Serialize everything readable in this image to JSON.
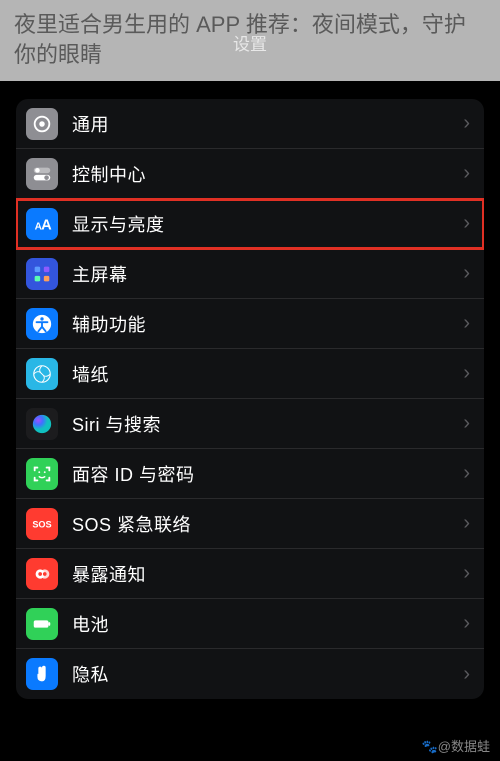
{
  "article_title": "夜里适合男生用的 APP 推荐：夜间模式，守护你的眼睛",
  "header": {
    "title": "设置"
  },
  "list": [
    {
      "label": "通用",
      "icon": "gear-icon",
      "bg": "bg-gray",
      "hl": false
    },
    {
      "label": "控制中心",
      "icon": "toggles-icon",
      "bg": "bg-gray2",
      "hl": false
    },
    {
      "label": "显示与亮度",
      "icon": "text-size-icon",
      "bg": "bg-blue",
      "hl": true
    },
    {
      "label": "主屏幕",
      "icon": "home-grid-icon",
      "bg": "bg-indigo",
      "hl": false
    },
    {
      "label": "辅助功能",
      "icon": "accessibility-icon",
      "bg": "bg-blue2",
      "hl": false
    },
    {
      "label": "墙纸",
      "icon": "wallpaper-icon",
      "bg": "bg-cyan",
      "hl": false
    },
    {
      "label": "Siri 与搜索",
      "icon": "siri-icon",
      "bg": "bg-black",
      "hl": false
    },
    {
      "label": "面容 ID 与密码",
      "icon": "faceid-icon",
      "bg": "bg-green",
      "hl": false
    },
    {
      "label": "SOS 紧急联络",
      "icon": "sos-icon",
      "bg": "bg-red",
      "hl": false
    },
    {
      "label": "暴露通知",
      "icon": "exposure-icon",
      "bg": "bg-redi",
      "hl": false
    },
    {
      "label": "电池",
      "icon": "battery-icon",
      "bg": "bg-green2",
      "hl": false
    },
    {
      "label": "隐私",
      "icon": "hand-icon",
      "bg": "bg-bluep",
      "hl": false
    }
  ],
  "watermark": "🐾@数据蛙"
}
